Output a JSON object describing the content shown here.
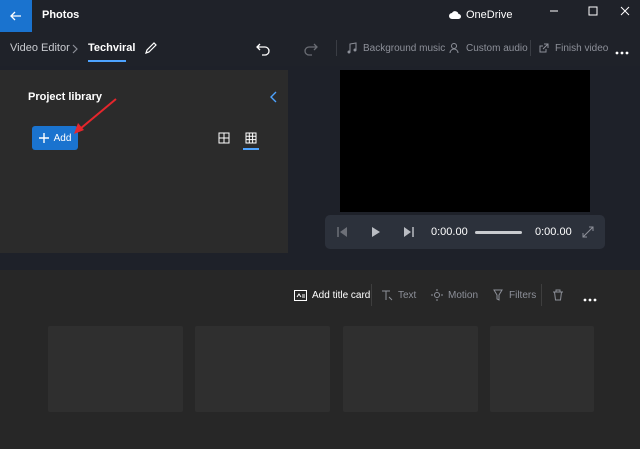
{
  "titlebar": {
    "app_title": "Photos",
    "cloud_label": "OneDrive"
  },
  "toolbar": {
    "breadcrumb_root": "Video Editor",
    "project_name": "Techviral",
    "background_music": "Background music",
    "custom_audio": "Custom audio",
    "finish_video": "Finish video"
  },
  "library": {
    "title": "Project library",
    "add_label": "Add"
  },
  "player": {
    "current_time": "0:00.00",
    "total_time": "0:00.00"
  },
  "timeline": {
    "add_title_card": "Add title card",
    "text": "Text",
    "motion": "Motion",
    "filters": "Filters"
  },
  "colors": {
    "accent": "#1a73cf",
    "highlight": "#4da3ff",
    "annotation_arrow": "#e5262c"
  }
}
